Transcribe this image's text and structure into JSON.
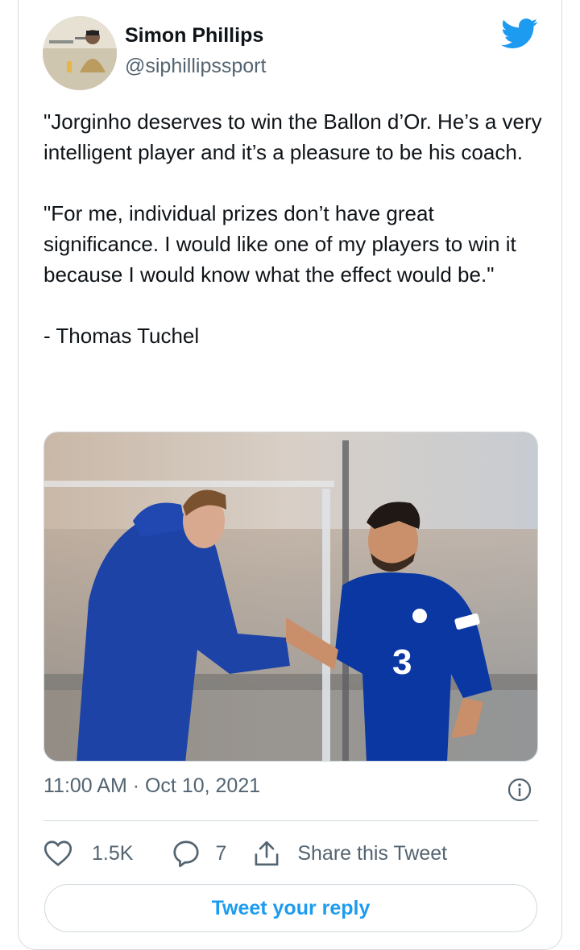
{
  "author": {
    "name": "Simon Phillips",
    "handle": "@siphillipssport"
  },
  "tweet": {
    "paragraphs": [
      "\"Jorginho deserves to win the Ballon d’Or. He’s a very intelligent player and it’s a pleasure to be his coach.",
      "\"For me, individual prizes don’t have great significance. I would like one of my players to win it because I would know what the effect would be.\"",
      "- Thomas Tuchel"
    ],
    "timestamp": "11:00 AM · Oct 10, 2021"
  },
  "actions": {
    "likes": "1.5K",
    "replies": "7",
    "share_label": "Share this Tweet"
  },
  "reply_button_label": "Tweet your reply",
  "colors": {
    "accent": "#1d9bf0",
    "secondary_text": "#536471",
    "border": "#cfd9de"
  },
  "icons": [
    "twitter-bird-icon",
    "info-icon",
    "heart-icon",
    "reply-bubble-icon",
    "share-icon"
  ]
}
